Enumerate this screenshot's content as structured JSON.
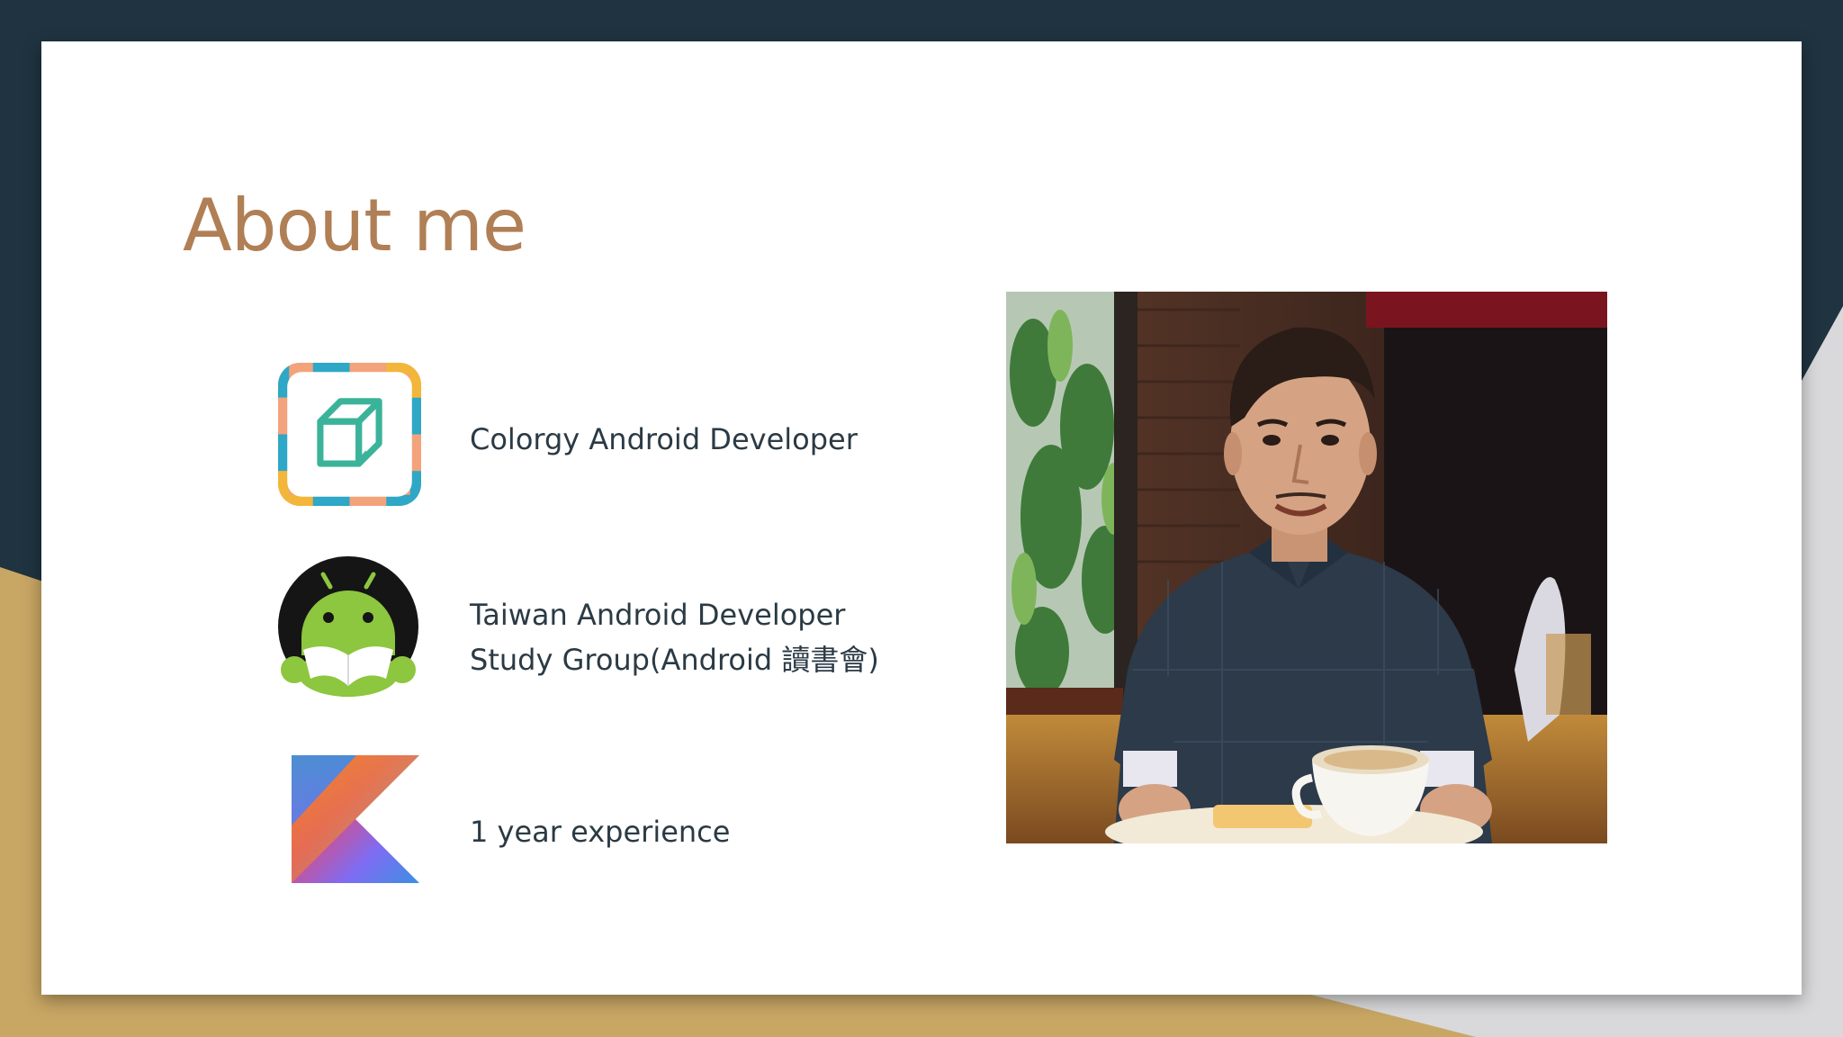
{
  "slide": {
    "title": "About me",
    "items": [
      {
        "icon": "colorgy-logo-icon",
        "lines": [
          "Colorgy Android Developer"
        ]
      },
      {
        "icon": "android-study-group-logo-icon",
        "lines": [
          "Taiwan Android Developer",
          "Study Group(Android 讀書會)"
        ]
      },
      {
        "icon": "kotlin-logo-icon",
        "lines": [
          "1 year experience"
        ]
      }
    ]
  },
  "colors": {
    "title": "#b07f55",
    "background_dark": "#1f3340",
    "background_gold": "#c8a664",
    "background_gray": "#d9d9db",
    "text": "#2b3a44"
  }
}
